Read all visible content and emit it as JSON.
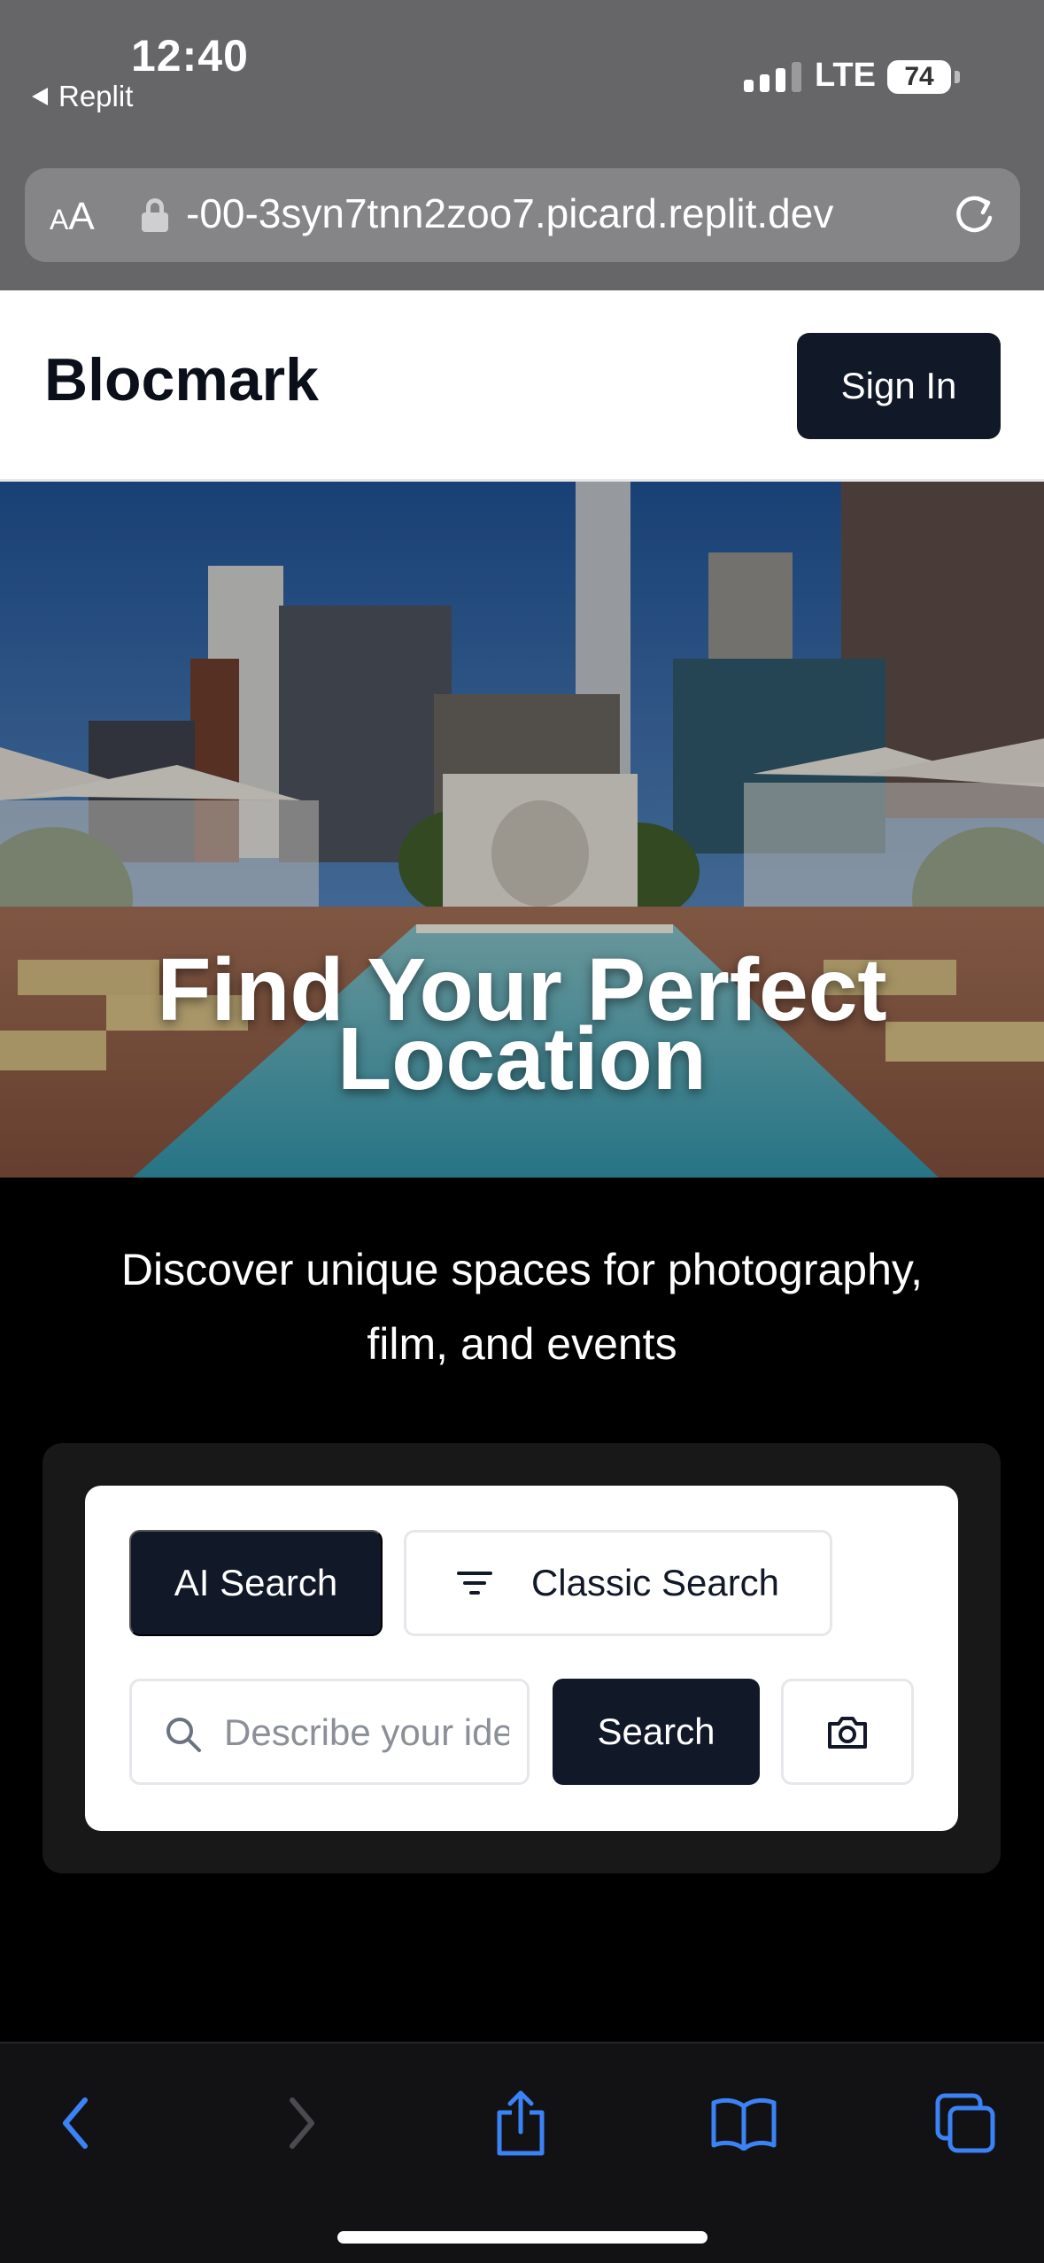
{
  "status_bar": {
    "time": "12:40",
    "back_app": "Replit",
    "network": "LTE",
    "battery": "74"
  },
  "browser": {
    "text_size_label": "AA",
    "url": "-00-3syn7tnn2zoo7.picard.replit.dev"
  },
  "header": {
    "brand": "Blocmark",
    "sign_in": "Sign In"
  },
  "hero": {
    "title_line1": "Find Your Perfect",
    "title_line2": "Location"
  },
  "intro": {
    "subtitle_line1": "Discover unique spaces for photography,",
    "subtitle_line2": "film, and events"
  },
  "search": {
    "tab_ai": "AI Search",
    "tab_classic": "Classic Search",
    "placeholder": "Describe your ideal location...",
    "button": "Search"
  },
  "icons": {
    "back": "chevron-left-icon",
    "forward": "chevron-right-icon",
    "share": "share-icon",
    "bookmarks": "book-icon",
    "tabs": "tabs-icon",
    "camera": "camera-icon",
    "search": "magnifier-icon",
    "filter": "filter-icon",
    "reload": "reload-icon",
    "lock": "lock-icon"
  },
  "colors": {
    "primary": "#111827",
    "toolbar_accent": "#3b82f6"
  }
}
